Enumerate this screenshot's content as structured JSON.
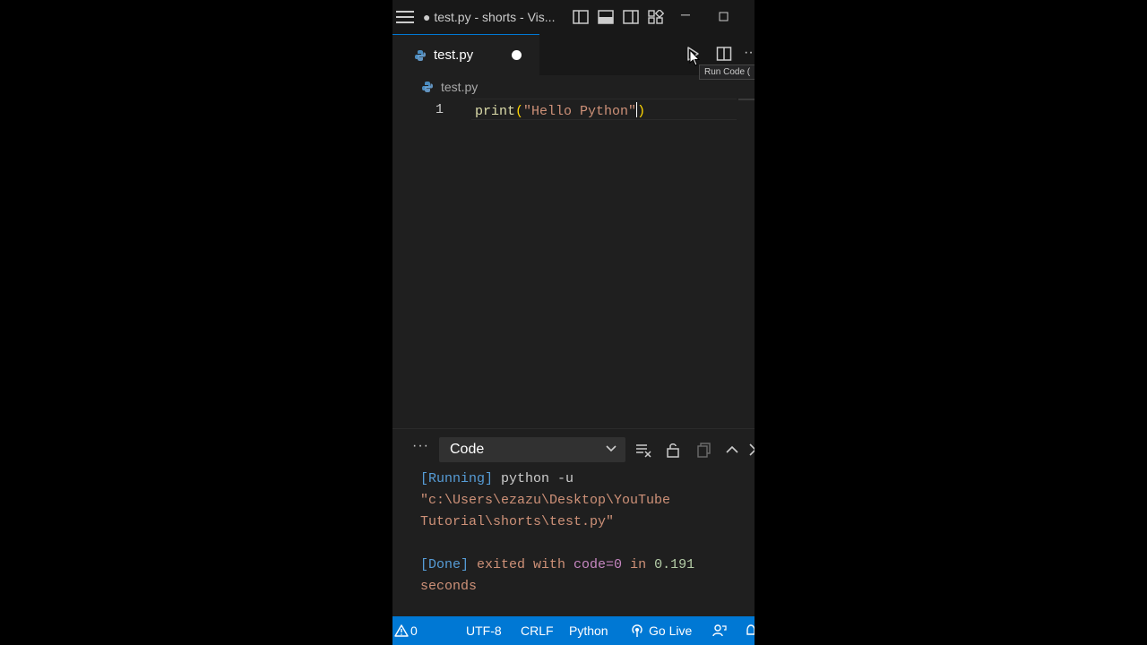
{
  "titlebar": {
    "title": "● test.py - shorts - Vis..."
  },
  "tab": {
    "label": "test.py",
    "modified": true
  },
  "toolbar": {
    "run_tooltip": "Run Code ("
  },
  "breadcrumb": {
    "file": "test.py"
  },
  "editor": {
    "line_number": "1",
    "code": {
      "fn": "print",
      "open_paren": "(",
      "string": "\"Hello Python\"",
      "close_paren": ")"
    }
  },
  "panel": {
    "more_label": "···",
    "dropdown_value": "Code",
    "output": {
      "running_tag": "[Running]",
      "command": " python -u",
      "path_line1": "\"c:\\Users\\ezazu\\Desktop\\YouTube",
      "path_line2": "Tutorial\\shorts\\test.py\"",
      "done_tag": "[Done]",
      "exited_text": " exited with ",
      "code_text": "code=0",
      "in_text": " in ",
      "time_value": "0.191",
      "seconds_text": "seconds"
    }
  },
  "statusbar": {
    "warnings": "0",
    "encoding": "UTF-8",
    "eol": "CRLF",
    "language": "Python",
    "go_live": "Go Live"
  },
  "colors": {
    "accent": "#0078d4",
    "editor_bg": "#1f1f1f",
    "titlebar_bg": "#181818"
  }
}
